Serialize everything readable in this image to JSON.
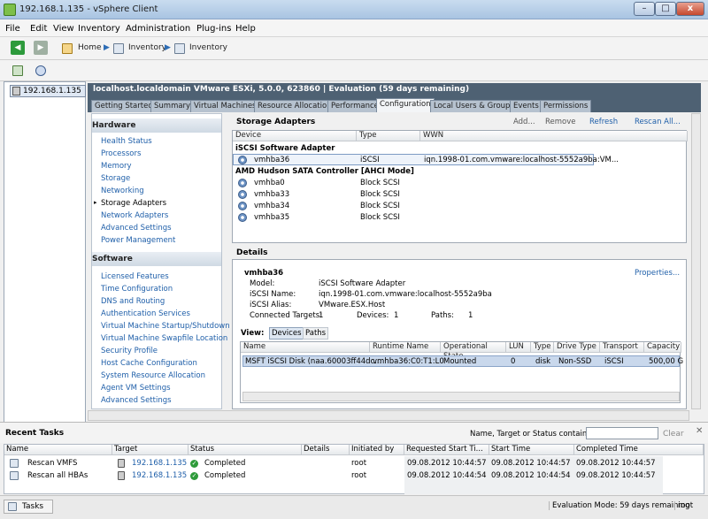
{
  "window": {
    "title": "192.168.1.135 - vSphere Client",
    "btn_min": "–",
    "btn_max": "□",
    "btn_close": "x"
  },
  "menu": [
    "File",
    "Edit",
    "View",
    "Inventory",
    "Administration",
    "Plug-ins",
    "Help"
  ],
  "nav": {
    "home": "Home",
    "inv1": "Inventory",
    "inv2": "Inventory"
  },
  "tree": {
    "host": "192.168.1.135"
  },
  "host_header": "localhost.localdomain VMware ESXi, 5.0.0, 623860 | Evaluation (59 days remaining)",
  "tabs": [
    "Getting Started",
    "Summary",
    "Virtual Machines",
    "Resource Allocation",
    "Performance",
    "Configuration",
    "Local Users & Groups",
    "Events",
    "Permissions"
  ],
  "hardware": {
    "header": "Hardware",
    "items": [
      "Health Status",
      "Processors",
      "Memory",
      "Storage",
      "Networking",
      "Storage Adapters",
      "Network Adapters",
      "Advanced Settings",
      "Power Management"
    ]
  },
  "software": {
    "header": "Software",
    "items": [
      "Licensed Features",
      "Time Configuration",
      "DNS and Routing",
      "Authentication Services",
      "Virtual Machine Startup/Shutdown",
      "Virtual Machine Swapfile Location",
      "Security Profile",
      "Host Cache Configuration",
      "System Resource Allocation",
      "Agent VM Settings",
      "Advanced Settings"
    ]
  },
  "storage_adapters": {
    "title": "Storage Adapters",
    "actions": {
      "add": "Add...",
      "remove": "Remove",
      "refresh": "Refresh",
      "rescan": "Rescan All..."
    },
    "columns": [
      "Device",
      "Type",
      "WWN"
    ],
    "groups": [
      {
        "name": "iSCSI Software Adapter",
        "rows": [
          {
            "device": "vmhba36",
            "type": "iSCSI",
            "wwn": "iqn.1998-01.com.vmware:localhost-5552a9ba:VM..."
          }
        ]
      },
      {
        "name": "AMD Hudson SATA Controller [AHCI Mode]",
        "rows": [
          {
            "device": "vmhba0",
            "type": "Block SCSI",
            "wwn": ""
          },
          {
            "device": "vmhba33",
            "type": "Block SCSI",
            "wwn": ""
          },
          {
            "device": "vmhba34",
            "type": "Block SCSI",
            "wwn": ""
          },
          {
            "device": "vmhba35",
            "type": "Block SCSI",
            "wwn": ""
          }
        ]
      }
    ]
  },
  "details": {
    "title": "Details",
    "adapter": "vmhba36",
    "properties": "Properties...",
    "model_label": "Model:",
    "model": "iSCSI Software Adapter",
    "iscsi_name_label": "iSCSI Name:",
    "iscsi_name": "iqn.1998-01.com.vmware:localhost-5552a9ba",
    "iscsi_alias_label": "iSCSI Alias:",
    "iscsi_alias": "VMware.ESX.Host",
    "targets_label": "Connected Targets:",
    "targets": "1",
    "devices_label": "Devices:",
    "devices": "1",
    "paths_label": "Paths:",
    "paths": "1",
    "view_label": "View:",
    "view_devices": "Devices",
    "view_paths": "Paths",
    "columns": [
      "Name",
      "Runtime Name",
      "Operational State",
      "LUN",
      "Type",
      "Drive Type",
      "Transport",
      "Capacity"
    ],
    "row": {
      "name": "MSFT iSCSI Disk (naa.60003ff44dc...",
      "runtime": "vmhba36:C0:T1:L0",
      "state": "Mounted",
      "lun": "0",
      "type": "disk",
      "drive": "Non-SSD",
      "transport": "iSCSI",
      "capacity": "500,00 G"
    }
  },
  "recent_tasks": {
    "title": "Recent Tasks",
    "filter_label": "Name, Target or Status contains: ▾",
    "filter_value": "",
    "clear": "Clear",
    "close": "✕",
    "columns": [
      "Name",
      "Target",
      "Status",
      "Details",
      "Initiated by",
      "Requested Start Ti...",
      "Start Time",
      "Completed Time"
    ],
    "rows": [
      {
        "name": "Rescan VMFS",
        "target": "192.168.1.135",
        "status": "Completed",
        "details": "",
        "by": "root",
        "requested": "09.08.2012 10:44:57",
        "start": "09.08.2012 10:44:57",
        "completed": "09.08.2012 10:44:57"
      },
      {
        "name": "Rescan all HBAs",
        "target": "192.168.1.135",
        "status": "Completed",
        "details": "",
        "by": "root",
        "requested": "09.08.2012 10:44:54",
        "start": "09.08.2012 10:44:54",
        "completed": "09.08.2012 10:44:57"
      }
    ]
  },
  "status": {
    "tasks": "Tasks",
    "evaluation": "Evaluation Mode: 59 days remaining",
    "user": "root"
  }
}
